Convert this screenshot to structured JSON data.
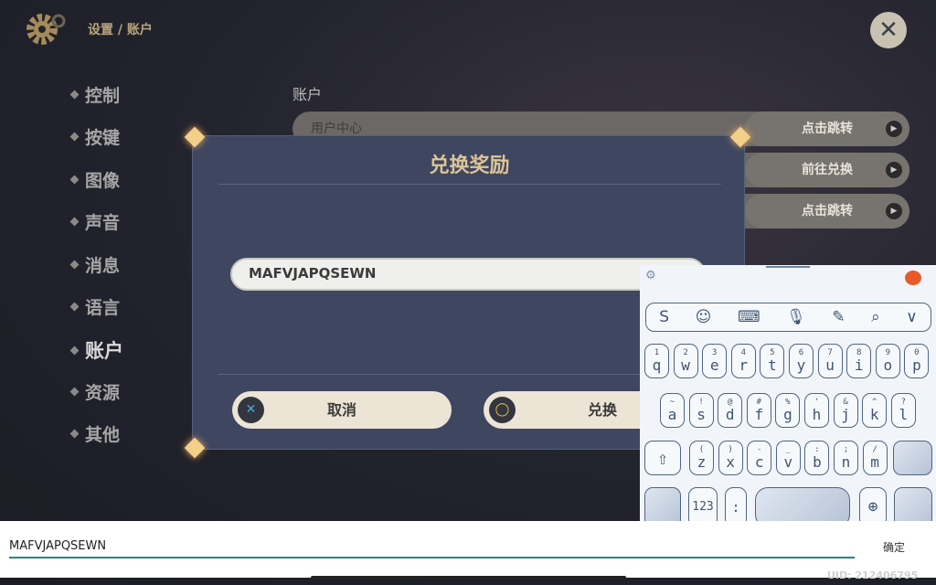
{
  "header": {
    "breadcrumb": "设置 / 账户",
    "close_icon": "close-icon",
    "gear_icon": "gear-icon"
  },
  "sidebar": {
    "items": [
      {
        "label": "控制"
      },
      {
        "label": "按键"
      },
      {
        "label": "图像"
      },
      {
        "label": "声音"
      },
      {
        "label": "消息"
      },
      {
        "label": "语言"
      },
      {
        "label": "账户",
        "active": true
      },
      {
        "label": "资源"
      },
      {
        "label": "其他"
      }
    ]
  },
  "main": {
    "section_title": "账户",
    "rows": [
      {
        "label": "用户中心",
        "button": "点击跳转"
      },
      {
        "label": "",
        "button": "前往兑换"
      },
      {
        "label": "",
        "button": "点击跳转"
      }
    ]
  },
  "dialog": {
    "title": "兑换奖励",
    "code_value": "MAFVJAPQSEWN",
    "cancel_label": "取消",
    "confirm_label": "兑换"
  },
  "keyboard": {
    "toolbar": [
      "S",
      "☺",
      "⌨",
      "🎙",
      "✎",
      "⌕",
      "∨"
    ],
    "row1": [
      [
        "1",
        "q"
      ],
      [
        "2",
        "w"
      ],
      [
        "3",
        "e"
      ],
      [
        "4",
        "r"
      ],
      [
        "5",
        "t"
      ],
      [
        "6",
        "y"
      ],
      [
        "7",
        "u"
      ],
      [
        "8",
        "i"
      ],
      [
        "9",
        "o"
      ],
      [
        "0",
        "p"
      ]
    ],
    "row2": [
      [
        "~",
        "a"
      ],
      [
        "!",
        "s"
      ],
      [
        "@",
        "d"
      ],
      [
        "#",
        "f"
      ],
      [
        "%",
        "g"
      ],
      [
        "'",
        "h"
      ],
      [
        "&",
        "j"
      ],
      [
        "^",
        "k"
      ],
      [
        "?",
        "l"
      ]
    ],
    "row3": [
      [
        "(",
        "z"
      ],
      [
        ")",
        "x"
      ],
      [
        "-",
        "c"
      ],
      [
        "_",
        "v"
      ],
      [
        ":",
        "b"
      ],
      [
        ";",
        "n"
      ],
      [
        "/",
        "m"
      ]
    ],
    "num_label": "123",
    "colon_label": ":"
  },
  "input_bar": {
    "value": "MAFVJAPQSEWN",
    "confirm_label": "确定"
  },
  "uid": "UID: 212406795",
  "colors": {
    "accent": "#dcc595",
    "dialog_bg": "#3e4660",
    "underline": "#1f8a7e"
  }
}
